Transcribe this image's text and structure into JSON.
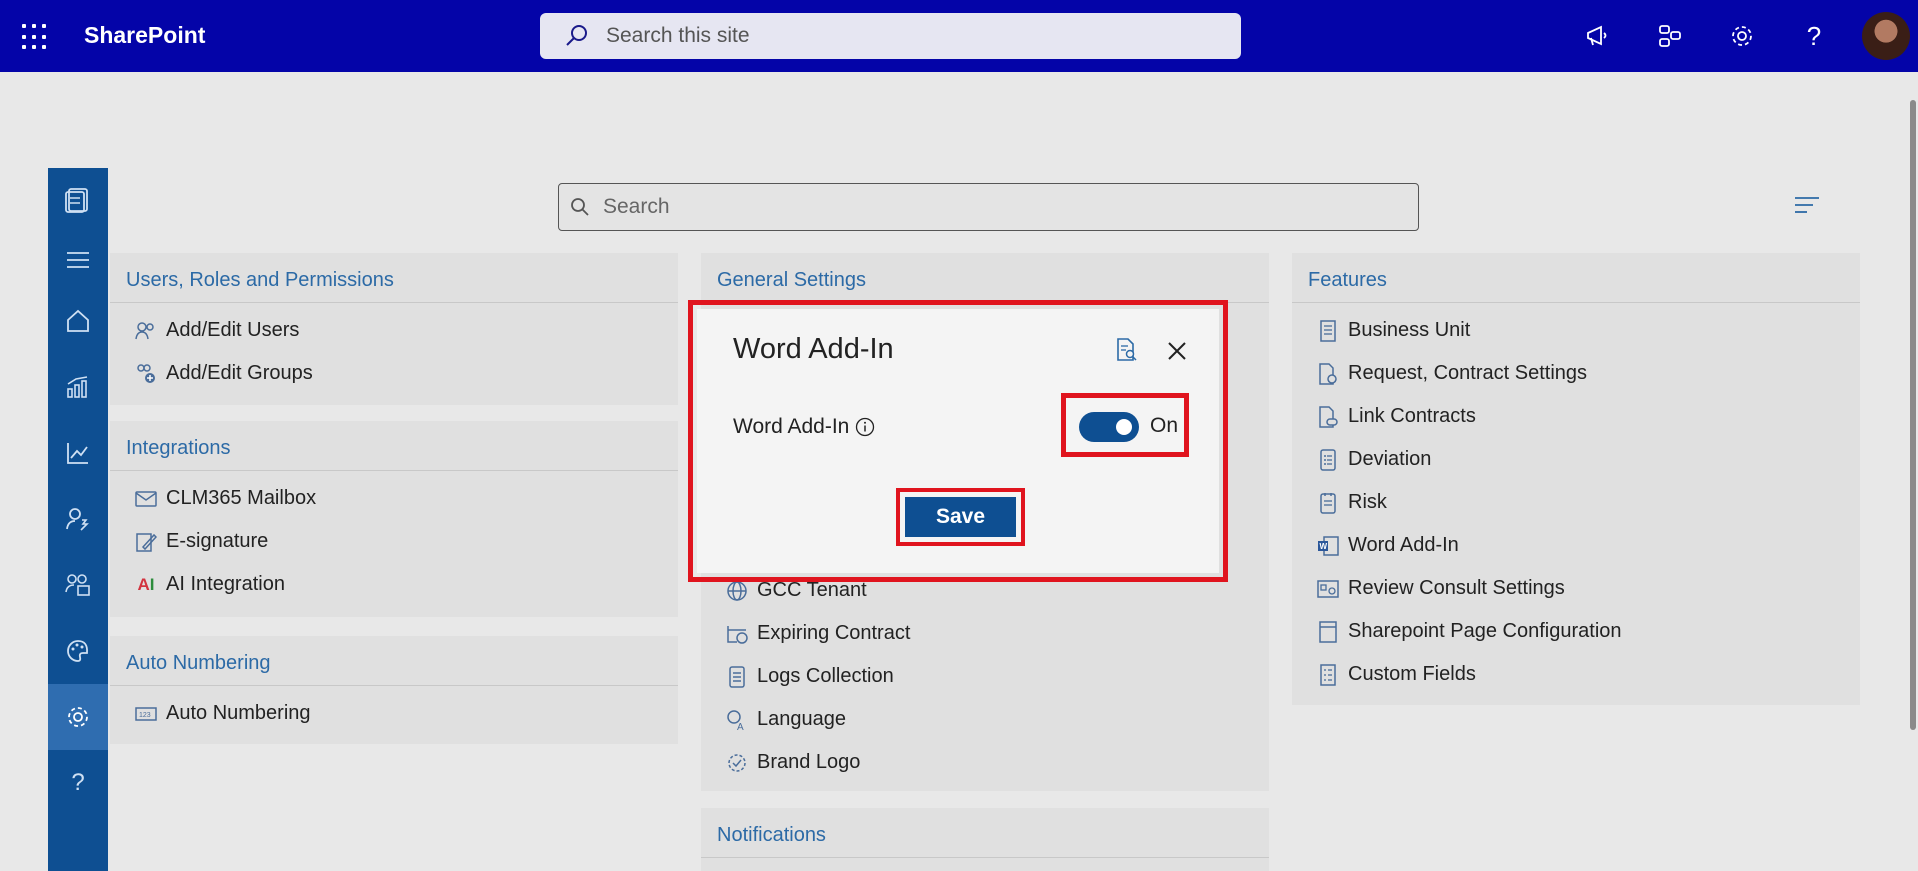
{
  "topbar": {
    "brand": "SharePoint",
    "search_placeholder": "Search this site",
    "icons": [
      "megaphone-icon",
      "share-icon",
      "gear-icon",
      "help-icon",
      "avatar"
    ]
  },
  "rail": {
    "items": [
      "documents-icon",
      "menu-icon",
      "home-icon",
      "analytics-icon",
      "trend-icon",
      "user-settings-icon",
      "groups-icon",
      "palette-icon",
      "gear-icon",
      "help-icon"
    ],
    "active": "gear-icon"
  },
  "main": {
    "search_placeholder": "Search"
  },
  "cards": {
    "users": {
      "title": "Users, Roles and Permissions",
      "items": [
        "Add/Edit Users",
        "Add/Edit Groups"
      ]
    },
    "integrations": {
      "title": "Integrations",
      "items": [
        "CLM365 Mailbox",
        "E-signature",
        "AI Integration"
      ]
    },
    "autonumbering": {
      "title": "Auto Numbering",
      "items": [
        "Auto Numbering"
      ]
    },
    "general": {
      "title": "General Settings",
      "items": [
        "GCC Tenant",
        "Expiring Contract",
        "Logs Collection",
        "Language",
        "Brand Logo"
      ]
    },
    "notifications": {
      "title": "Notifications"
    },
    "features": {
      "title": "Features",
      "items": [
        "Business Unit",
        "Request, Contract Settings",
        "Link Contracts",
        "Deviation",
        "Risk",
        "Word Add-In",
        "Review Consult Settings",
        "Sharepoint Page Configuration",
        "Custom Fields"
      ]
    }
  },
  "modal": {
    "title": "Word Add-In",
    "field_label": "Word Add-In",
    "toggle_state": "On",
    "save_label": "Save"
  },
  "colors": {
    "topbar": "#0404a8",
    "rail": "#0e4f92",
    "accent_title": "#2c6aa6",
    "highlight": "#e0141e"
  }
}
